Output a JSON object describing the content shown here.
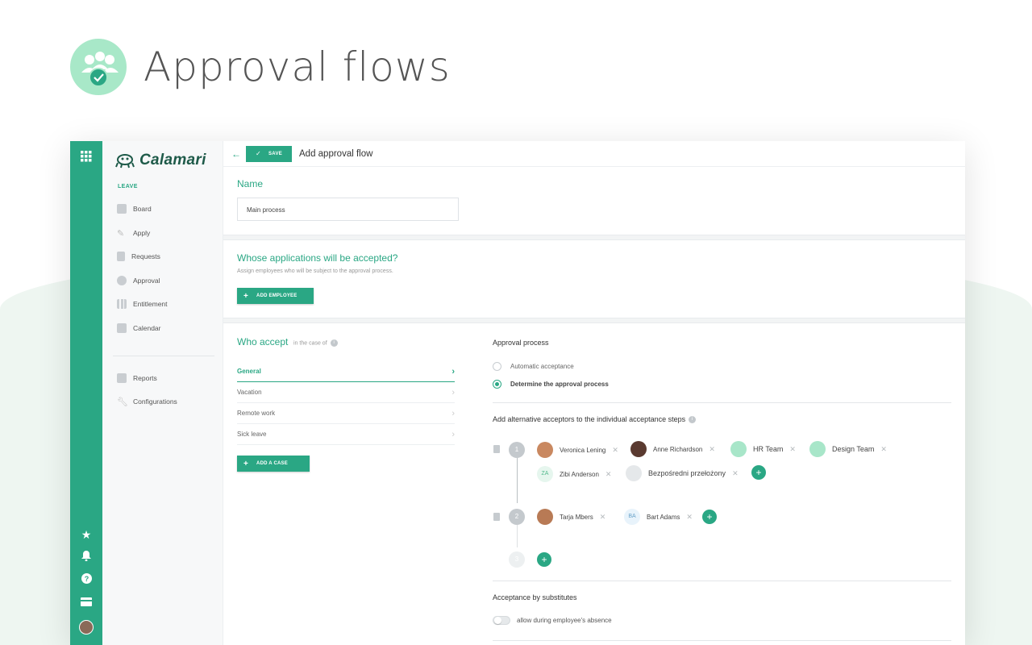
{
  "hero": {
    "title": "Approval flows",
    "icon": "approval-users-check-icon"
  },
  "app": {
    "logo": "Calamari",
    "colors": {
      "accent": "#2aa784",
      "rail": "#2aa784",
      "dark_text": "#1e5a49"
    },
    "sidebar": {
      "section": "LEAVE",
      "items": [
        {
          "label": "Board",
          "icon": "home-icon"
        },
        {
          "label": "Apply",
          "icon": "pencil-icon"
        },
        {
          "label": "Requests",
          "icon": "document-icon"
        },
        {
          "label": "Approval",
          "icon": "check-circle-icon"
        },
        {
          "label": "Entitlement",
          "icon": "bar-chart-icon"
        },
        {
          "label": "Calendar",
          "icon": "calendar-icon"
        }
      ],
      "items2": [
        {
          "label": "Reports",
          "icon": "factory-icon"
        },
        {
          "label": "Configurations",
          "icon": "wrench-icon"
        }
      ]
    },
    "topbar": {
      "save_label": "SAVE",
      "title": "Add approval flow"
    },
    "name_section": {
      "heading": "Name",
      "value": "Main process"
    },
    "whose": {
      "heading": "Whose applications will be accepted?",
      "hint": "Assign employees who will be subject to the approval process.",
      "button": "ADD EMPLOYEE"
    },
    "who_accept": {
      "heading": "Who accept",
      "hint": "in the case of",
      "cases": [
        "General",
        "Vacation",
        "Remote work",
        "Sick leave"
      ],
      "active_case": "General",
      "button": "ADD A CASE"
    },
    "approval_process": {
      "heading": "Approval process",
      "options": [
        "Automatic acceptance",
        "Determine the approval process"
      ],
      "selected": "Determine the approval process"
    },
    "alt_acceptors": {
      "heading": "Add alternative acceptors to the individual acceptance steps",
      "steps": [
        {
          "number": "1",
          "row1": [
            "Veronica Lening",
            "Anne Richardson",
            "HR Team",
            "Design Team"
          ],
          "row2": [
            "Zibi Anderson",
            "Bezpośredni przełożony"
          ],
          "initials": "ZA"
        },
        {
          "number": "2",
          "row1": [
            "Tarja Mbers",
            "Bart Adams"
          ],
          "initials": "BA"
        },
        {
          "number": "3"
        }
      ]
    },
    "substitutes": {
      "heading": "Acceptance by substitutes",
      "toggle_label": "allow during employee's absence",
      "toggle_on": false
    }
  }
}
